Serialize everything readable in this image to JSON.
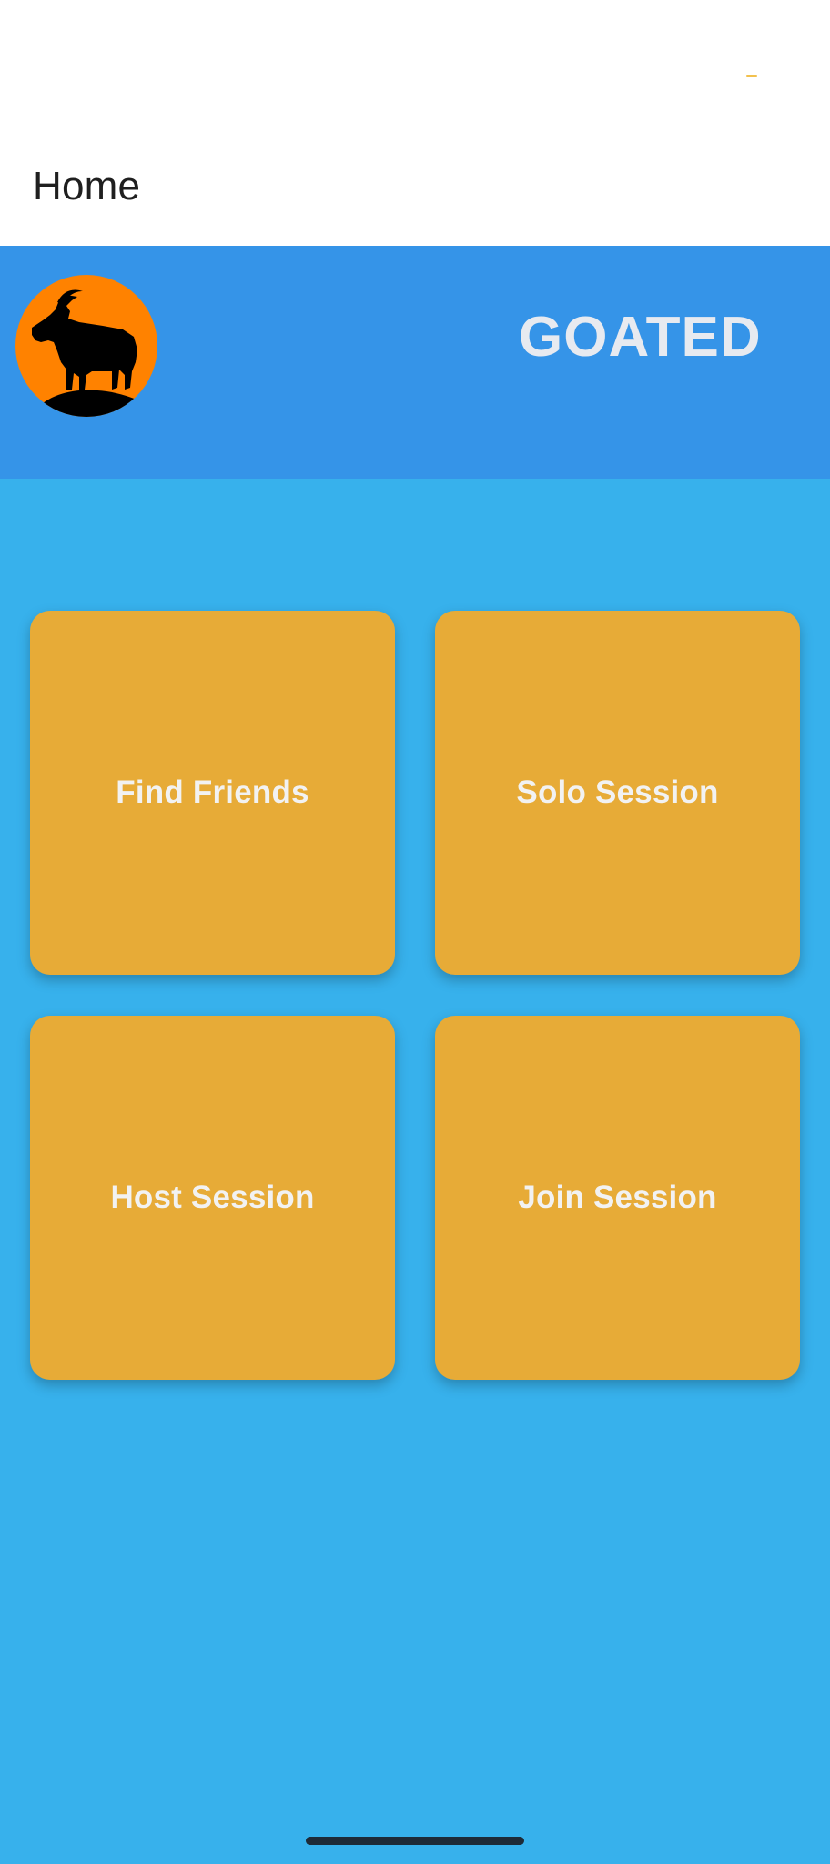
{
  "app_bar": {
    "title": "Home"
  },
  "header": {
    "brand": "GOATED",
    "logo_icon": "goat-logo-icon"
  },
  "tiles": [
    {
      "label": "Find Friends"
    },
    {
      "label": "Solo Session"
    },
    {
      "label": "Host Session"
    },
    {
      "label": "Join Session"
    }
  ],
  "colors": {
    "background": "#37b1ec",
    "header_band": "#3594e8",
    "tile": "#e7ab37",
    "logo_circle": "#ff8200",
    "brand_text": "#e7eaf0"
  }
}
